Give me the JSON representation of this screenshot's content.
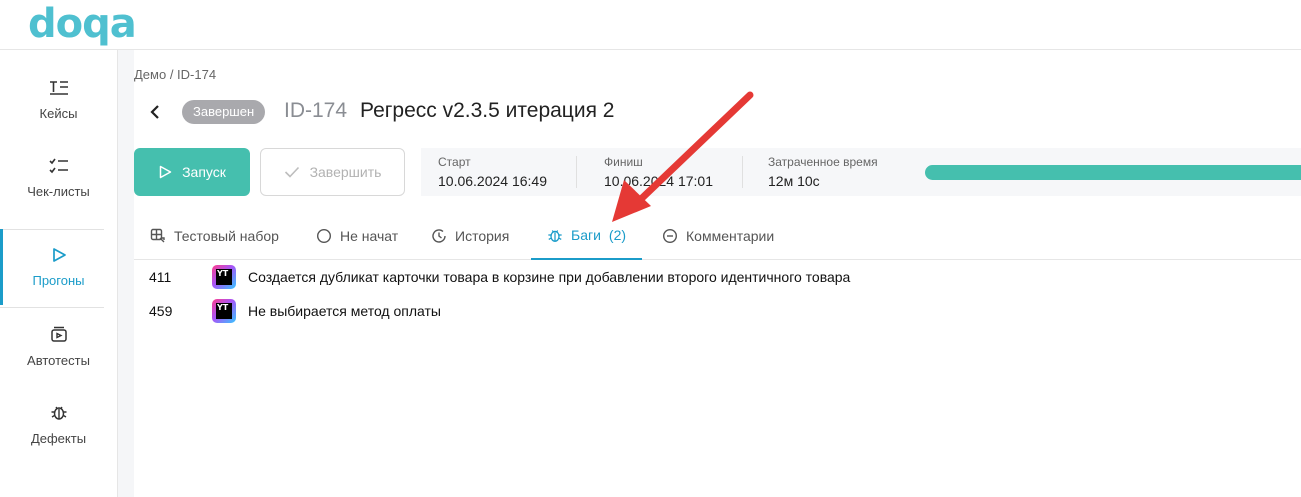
{
  "app": {
    "logo": "doqa"
  },
  "sidebar": {
    "items": [
      {
        "label": "Кейсы",
        "icon": "cases-icon",
        "active": false
      },
      {
        "label": "Чек-листы",
        "icon": "checklist-icon",
        "active": false
      },
      {
        "label": "Прогоны",
        "icon": "play-icon",
        "active": true
      },
      {
        "label": "Автотесты",
        "icon": "autotest-icon",
        "active": false
      },
      {
        "label": "Дефекты",
        "icon": "bug-icon",
        "active": false
      }
    ]
  },
  "header": {
    "breadcrumb": "Демо / ID-174",
    "status_badge": "Завершен",
    "run_id": "ID-174",
    "title": "Регресс v2.3.5 итерация 2"
  },
  "actions": {
    "start_label": "Запуск",
    "finish_label": "Завершить"
  },
  "stats": {
    "start_label": "Старт",
    "start_value": "10.06.2024 16:49",
    "finish_label": "Финиш",
    "finish_value": "10.06.2024 17:01",
    "elapsed_label": "Затраченное время",
    "elapsed_value": "12м 10с",
    "progress_fraction": 1.0
  },
  "tabs": [
    {
      "label": "Тестовый набор",
      "icon": "test-set-icon"
    },
    {
      "label": "Не начат",
      "icon": "circle-icon"
    },
    {
      "label": "История",
      "icon": "history-icon"
    },
    {
      "label": "Баги",
      "count": "(2)",
      "icon": "bug-icon",
      "active": true
    },
    {
      "label": "Комментарии",
      "icon": "comment-icon"
    }
  ],
  "bugs": [
    {
      "id": "411",
      "tracker": "YT",
      "title": "Создается дубликат карточки товара в корзине при добавлении второго идентичного товара"
    },
    {
      "id": "459",
      "tracker": "YT",
      "title": "Не выбирается метод оплаты"
    }
  ],
  "colors": {
    "accent": "#1b9cc9",
    "brand": "#4fc0d0",
    "success": "#45bfae",
    "annotation_arrow": "#e53935"
  }
}
